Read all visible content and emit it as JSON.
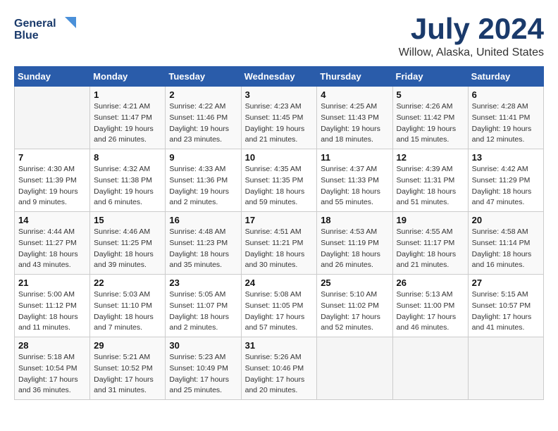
{
  "logo": {
    "line1": "General",
    "line2": "Blue"
  },
  "title": "July 2024",
  "location": "Willow, Alaska, United States",
  "weekdays": [
    "Sunday",
    "Monday",
    "Tuesday",
    "Wednesday",
    "Thursday",
    "Friday",
    "Saturday"
  ],
  "weeks": [
    [
      {
        "num": "",
        "info": ""
      },
      {
        "num": "1",
        "info": "Sunrise: 4:21 AM\nSunset: 11:47 PM\nDaylight: 19 hours\nand 26 minutes."
      },
      {
        "num": "2",
        "info": "Sunrise: 4:22 AM\nSunset: 11:46 PM\nDaylight: 19 hours\nand 23 minutes."
      },
      {
        "num": "3",
        "info": "Sunrise: 4:23 AM\nSunset: 11:45 PM\nDaylight: 19 hours\nand 21 minutes."
      },
      {
        "num": "4",
        "info": "Sunrise: 4:25 AM\nSunset: 11:43 PM\nDaylight: 19 hours\nand 18 minutes."
      },
      {
        "num": "5",
        "info": "Sunrise: 4:26 AM\nSunset: 11:42 PM\nDaylight: 19 hours\nand 15 minutes."
      },
      {
        "num": "6",
        "info": "Sunrise: 4:28 AM\nSunset: 11:41 PM\nDaylight: 19 hours\nand 12 minutes."
      }
    ],
    [
      {
        "num": "7",
        "info": "Sunrise: 4:30 AM\nSunset: 11:39 PM\nDaylight: 19 hours\nand 9 minutes."
      },
      {
        "num": "8",
        "info": "Sunrise: 4:32 AM\nSunset: 11:38 PM\nDaylight: 19 hours\nand 6 minutes."
      },
      {
        "num": "9",
        "info": "Sunrise: 4:33 AM\nSunset: 11:36 PM\nDaylight: 19 hours\nand 2 minutes."
      },
      {
        "num": "10",
        "info": "Sunrise: 4:35 AM\nSunset: 11:35 PM\nDaylight: 18 hours\nand 59 minutes."
      },
      {
        "num": "11",
        "info": "Sunrise: 4:37 AM\nSunset: 11:33 PM\nDaylight: 18 hours\nand 55 minutes."
      },
      {
        "num": "12",
        "info": "Sunrise: 4:39 AM\nSunset: 11:31 PM\nDaylight: 18 hours\nand 51 minutes."
      },
      {
        "num": "13",
        "info": "Sunrise: 4:42 AM\nSunset: 11:29 PM\nDaylight: 18 hours\nand 47 minutes."
      }
    ],
    [
      {
        "num": "14",
        "info": "Sunrise: 4:44 AM\nSunset: 11:27 PM\nDaylight: 18 hours\nand 43 minutes."
      },
      {
        "num": "15",
        "info": "Sunrise: 4:46 AM\nSunset: 11:25 PM\nDaylight: 18 hours\nand 39 minutes."
      },
      {
        "num": "16",
        "info": "Sunrise: 4:48 AM\nSunset: 11:23 PM\nDaylight: 18 hours\nand 35 minutes."
      },
      {
        "num": "17",
        "info": "Sunrise: 4:51 AM\nSunset: 11:21 PM\nDaylight: 18 hours\nand 30 minutes."
      },
      {
        "num": "18",
        "info": "Sunrise: 4:53 AM\nSunset: 11:19 PM\nDaylight: 18 hours\nand 26 minutes."
      },
      {
        "num": "19",
        "info": "Sunrise: 4:55 AM\nSunset: 11:17 PM\nDaylight: 18 hours\nand 21 minutes."
      },
      {
        "num": "20",
        "info": "Sunrise: 4:58 AM\nSunset: 11:14 PM\nDaylight: 18 hours\nand 16 minutes."
      }
    ],
    [
      {
        "num": "21",
        "info": "Sunrise: 5:00 AM\nSunset: 11:12 PM\nDaylight: 18 hours\nand 11 minutes."
      },
      {
        "num": "22",
        "info": "Sunrise: 5:03 AM\nSunset: 11:10 PM\nDaylight: 18 hours\nand 7 minutes."
      },
      {
        "num": "23",
        "info": "Sunrise: 5:05 AM\nSunset: 11:07 PM\nDaylight: 18 hours\nand 2 minutes."
      },
      {
        "num": "24",
        "info": "Sunrise: 5:08 AM\nSunset: 11:05 PM\nDaylight: 17 hours\nand 57 minutes."
      },
      {
        "num": "25",
        "info": "Sunrise: 5:10 AM\nSunset: 11:02 PM\nDaylight: 17 hours\nand 52 minutes."
      },
      {
        "num": "26",
        "info": "Sunrise: 5:13 AM\nSunset: 11:00 PM\nDaylight: 17 hours\nand 46 minutes."
      },
      {
        "num": "27",
        "info": "Sunrise: 5:15 AM\nSunset: 10:57 PM\nDaylight: 17 hours\nand 41 minutes."
      }
    ],
    [
      {
        "num": "28",
        "info": "Sunrise: 5:18 AM\nSunset: 10:54 PM\nDaylight: 17 hours\nand 36 minutes."
      },
      {
        "num": "29",
        "info": "Sunrise: 5:21 AM\nSunset: 10:52 PM\nDaylight: 17 hours\nand 31 minutes."
      },
      {
        "num": "30",
        "info": "Sunrise: 5:23 AM\nSunset: 10:49 PM\nDaylight: 17 hours\nand 25 minutes."
      },
      {
        "num": "31",
        "info": "Sunrise: 5:26 AM\nSunset: 10:46 PM\nDaylight: 17 hours\nand 20 minutes."
      },
      {
        "num": "",
        "info": ""
      },
      {
        "num": "",
        "info": ""
      },
      {
        "num": "",
        "info": ""
      }
    ]
  ]
}
